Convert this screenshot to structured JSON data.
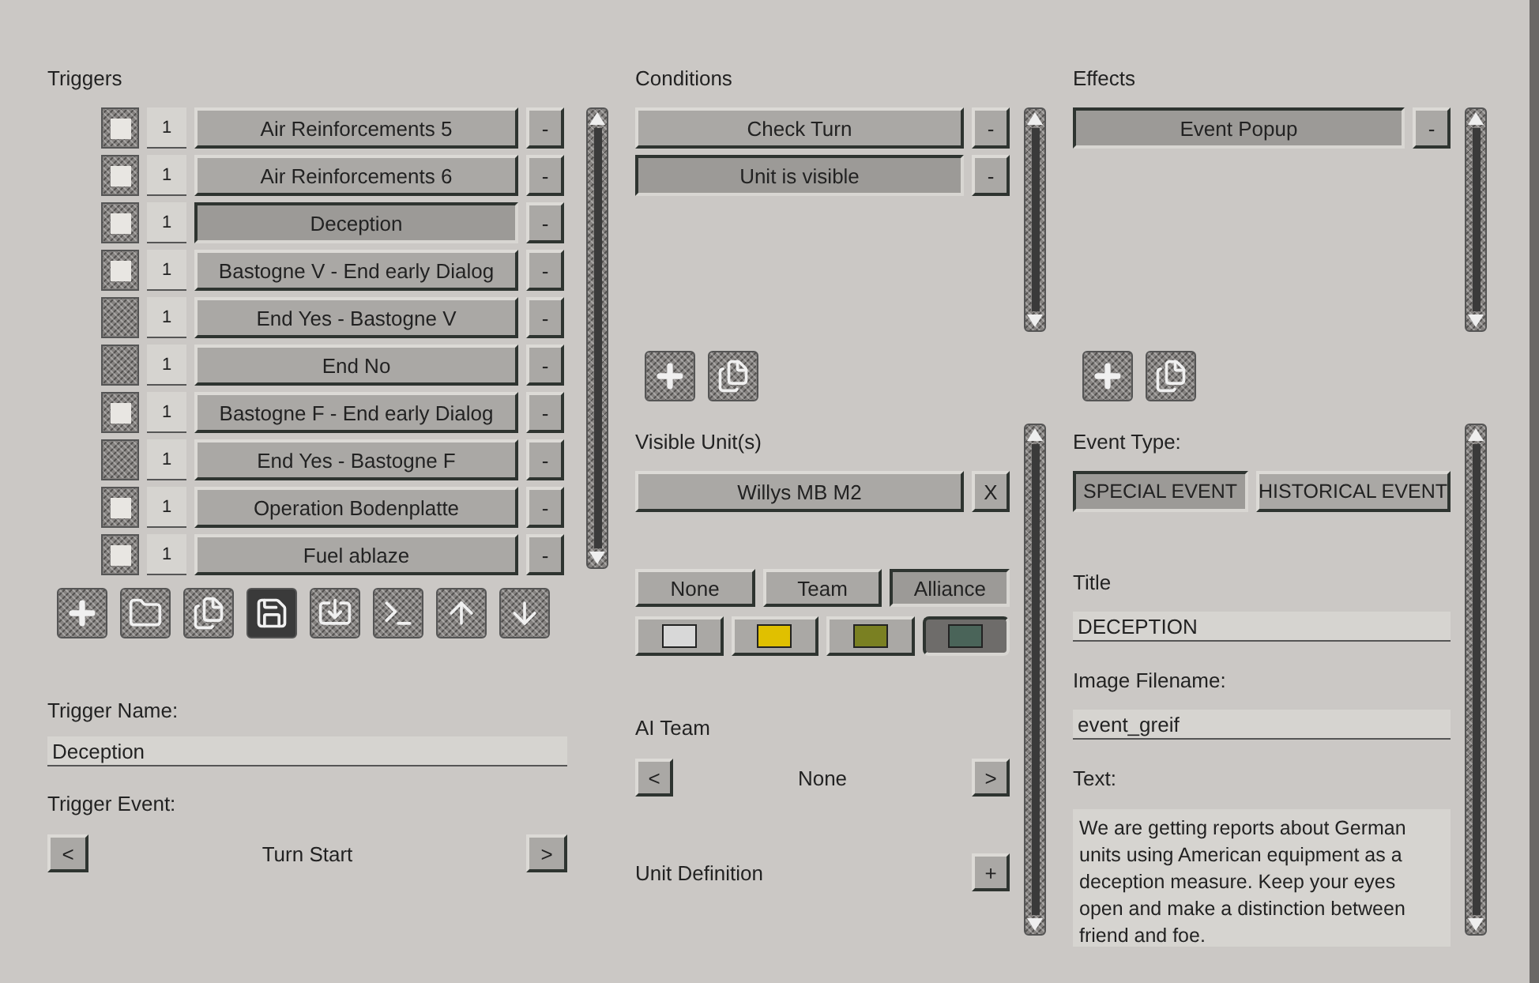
{
  "triggers": {
    "heading": "Triggers",
    "rows": [
      {
        "checked": true,
        "count": "1",
        "name": "Air Reinforcements 5",
        "selected": false,
        "remove": "-"
      },
      {
        "checked": true,
        "count": "1",
        "name": "Air Reinforcements 6",
        "selected": false,
        "remove": "-"
      },
      {
        "checked": true,
        "count": "1",
        "name": "Deception",
        "selected": true,
        "remove": "-"
      },
      {
        "checked": true,
        "count": "1",
        "name": "Bastogne V - End early Dialog",
        "selected": false,
        "remove": "-"
      },
      {
        "checked": false,
        "count": "1",
        "name": "End Yes - Bastogne V",
        "selected": false,
        "remove": "-"
      },
      {
        "checked": false,
        "count": "1",
        "name": "End No",
        "selected": false,
        "remove": "-"
      },
      {
        "checked": true,
        "count": "1",
        "name": "Bastogne F - End early Dialog",
        "selected": false,
        "remove": "-"
      },
      {
        "checked": false,
        "count": "1",
        "name": "End Yes - Bastogne F",
        "selected": false,
        "remove": "-"
      },
      {
        "checked": true,
        "count": "1",
        "name": "Operation Bodenplatte",
        "selected": false,
        "remove": "-"
      },
      {
        "checked": true,
        "count": "1",
        "name": "Fuel ablaze",
        "selected": false,
        "remove": "-"
      }
    ],
    "toolbar": [
      {
        "kind": "add",
        "pressed": false
      },
      {
        "kind": "open",
        "pressed": false
      },
      {
        "kind": "copy",
        "pressed": false
      },
      {
        "kind": "save",
        "pressed": true
      },
      {
        "kind": "import",
        "pressed": false
      },
      {
        "kind": "console",
        "pressed": false
      },
      {
        "kind": "up",
        "pressed": false
      },
      {
        "kind": "down",
        "pressed": false
      }
    ],
    "name_label": "Trigger Name:",
    "name_value": "Deception",
    "event_label": "Trigger Event:",
    "event": {
      "prev": "<",
      "value": "Turn Start",
      "next": ">"
    }
  },
  "conditions": {
    "heading": "Conditions",
    "rows": [
      {
        "name": "Check Turn",
        "selected": false,
        "remove": "-"
      },
      {
        "name": "Unit is visible",
        "selected": true,
        "remove": "-"
      }
    ],
    "tools": [
      {
        "kind": "add"
      },
      {
        "kind": "copy"
      }
    ],
    "units_label": "Visible Unit(s)",
    "units": [
      {
        "name": "Willys MB M2",
        "remove": "X"
      }
    ],
    "scopes": [
      {
        "label": "None",
        "selected": false
      },
      {
        "label": "Team",
        "selected": false
      },
      {
        "label": "Alliance",
        "selected": true
      }
    ],
    "colors": [
      {
        "color": "#d8d8d8",
        "selected": false
      },
      {
        "color": "#e0c000",
        "selected": false
      },
      {
        "color": "#7a8022",
        "selected": false
      },
      {
        "color": "#4a6459",
        "selected": true
      }
    ],
    "ai_team": {
      "label": "AI Team",
      "prev": "<",
      "value": "None",
      "next": ">"
    },
    "unit_definition": {
      "label": "Unit Definition",
      "add": "+"
    }
  },
  "effects": {
    "heading": "Effects",
    "rows": [
      {
        "name": "Event Popup",
        "selected": true,
        "remove": "-"
      }
    ],
    "tools": [
      {
        "kind": "add"
      },
      {
        "kind": "copy"
      }
    ],
    "type_label": "Event Type:",
    "types": [
      {
        "label": "SPECIAL EVENT",
        "selected": true
      },
      {
        "label": "HISTORICAL EVENT",
        "selected": false
      }
    ],
    "title_label": "Title",
    "title_value": "DECEPTION",
    "image_label": "Image Filename:",
    "image_value": "event_greif",
    "text_label": "Text:",
    "text_value": "We are getting reports about German units using American equipment as a deception measure. Keep your eyes open and make a distinction between friend and foe."
  }
}
